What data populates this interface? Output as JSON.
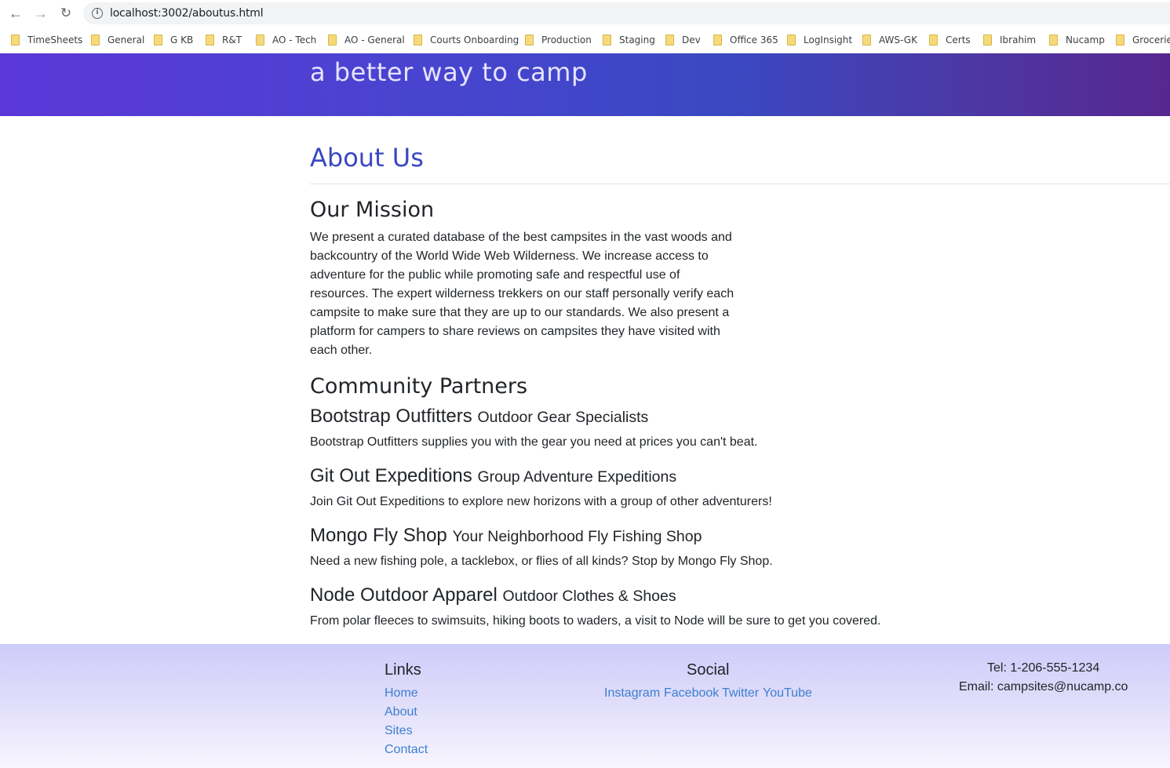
{
  "browser": {
    "url": "localhost:3002/aboutus.html",
    "bookmarks": [
      "TimeSheets",
      "General",
      "G KB",
      "R&T",
      "AO - Tech",
      "AO - General",
      "Courts Onboarding",
      "Production",
      "Staging",
      "Dev",
      "Office 365",
      "LogInsight",
      "AWS-GK",
      "Certs",
      "Ibrahim",
      "Nucamp",
      "Groceries"
    ]
  },
  "header": {
    "tagline": "a better way to camp"
  },
  "main": {
    "title": "About Us",
    "mission_heading": "Our Mission",
    "mission_text": "We present a curated database of the best campsites in the vast woods and backcountry of the World Wide Web Wilderness. We increase access to adventure for the public while promoting safe and respectful use of resources. The expert wilderness trekkers on our staff personally verify each campsite to make sure that they are up to our standards. We also present a platform for campers to share reviews on campsites they have visited with each other.",
    "partners_heading": "Community Partners",
    "partners": [
      {
        "name": "Bootstrap Outfitters",
        "tagline": "Outdoor Gear Specialists",
        "description": "Bootstrap Outfitters supplies you with the gear you need at prices you can't beat."
      },
      {
        "name": "Git Out Expeditions",
        "tagline": "Group Adventure Expeditions",
        "description": "Join Git Out Expeditions to explore new horizons with a group of other adventurers!"
      },
      {
        "name": "Mongo Fly Shop",
        "tagline": "Your Neighborhood Fly Fishing Shop",
        "description": "Need a new fishing pole, a tacklebox, or flies of all kinds? Stop by Mongo Fly Shop."
      },
      {
        "name": "Node Outdoor Apparel",
        "tagline": "Outdoor Clothes & Shoes",
        "description": "From polar fleeces to swimsuits, hiking boots to waders, a visit to Node will be sure to get you covered."
      }
    ]
  },
  "footer": {
    "links_heading": "Links",
    "links": [
      "Home",
      "About",
      "Sites",
      "Contact"
    ],
    "social_heading": "Social",
    "social": [
      "Instagram",
      "Facebook",
      "Twitter",
      "YouTube"
    ],
    "tel": "Tel: 1-206-555-1234",
    "email": "Email: campsites@nucamp.co"
  },
  "colors": {
    "title_blue": "#3a47c2",
    "link_blue": "#3c7fd0",
    "header_gradient_start": "#5c37d8",
    "header_gradient_end": "#57278f",
    "footer_top": "#cfcbf9"
  }
}
